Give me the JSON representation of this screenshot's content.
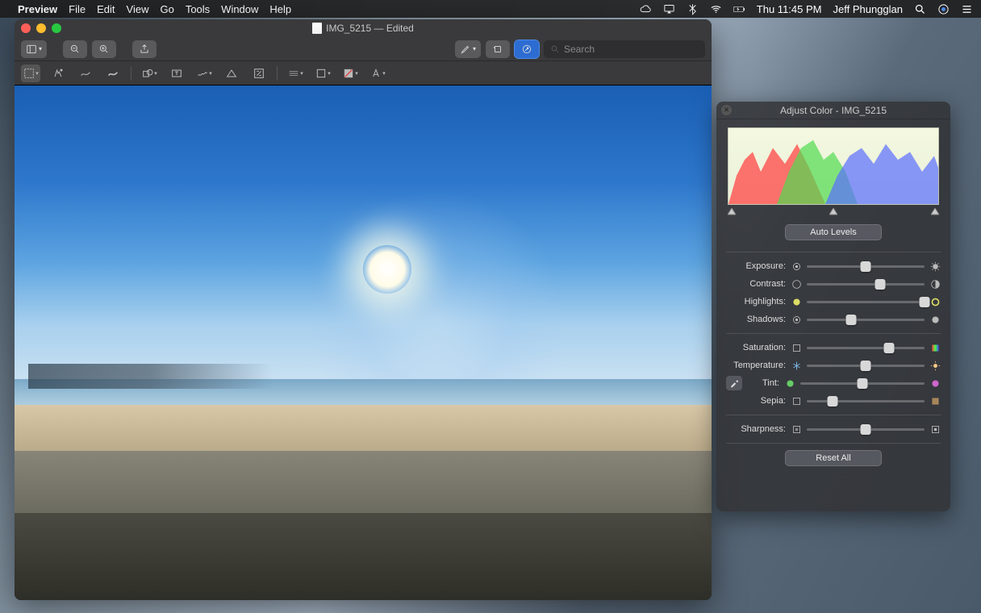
{
  "menubar": {
    "app": "Preview",
    "items": [
      "File",
      "Edit",
      "View",
      "Go",
      "Tools",
      "Window",
      "Help"
    ],
    "clock": "Thu 11:45 PM",
    "user": "Jeff Phungglan"
  },
  "window": {
    "title": "IMG_5215 — Edited",
    "search_placeholder": "Search"
  },
  "panel": {
    "title": "Adjust Color - IMG_5215",
    "auto_levels": "Auto Levels",
    "reset_all": "Reset All",
    "sliders": [
      {
        "label": "Exposure:",
        "pos": 50
      },
      {
        "label": "Contrast:",
        "pos": 62
      },
      {
        "label": "Highlights:",
        "pos": 100
      },
      {
        "label": "Shadows:",
        "pos": 38
      }
    ],
    "color_sliders": [
      {
        "label": "Saturation:",
        "pos": 70
      },
      {
        "label": "Temperature:",
        "pos": 50
      },
      {
        "label": "Tint:",
        "pos": 50,
        "eyedropper": true
      },
      {
        "label": "Sepia:",
        "pos": 22
      }
    ],
    "sharpness": {
      "label": "Sharpness:",
      "pos": 50
    }
  }
}
